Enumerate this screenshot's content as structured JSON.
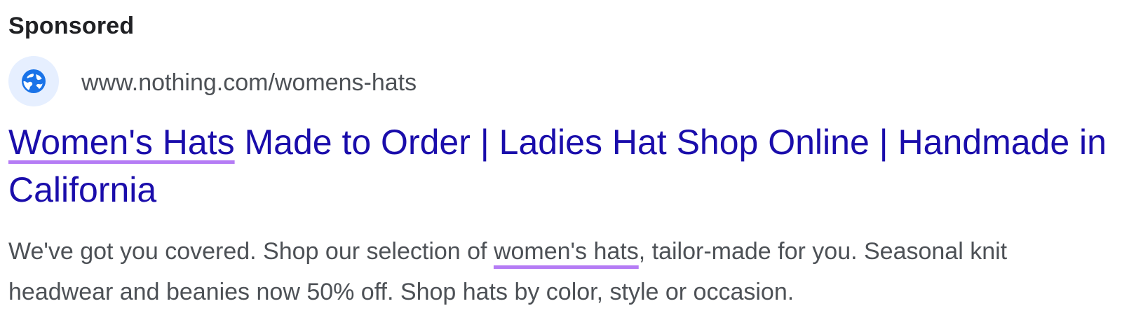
{
  "ad": {
    "label": "Sponsored",
    "icon": "globe-icon",
    "display_url": "www.nothing.com/womens-hats",
    "headline": {
      "highlight": "Women's Hats",
      "rest": " Made to Order | Ladies Hat Shop Online | Handmade in California"
    },
    "description": {
      "before": "We've got you covered. Shop our selection of ",
      "highlight": "women's hats",
      "after": ", tailor-made for you. Seasonal knit headwear and beanies now 50% off. Shop hats by color, style or occasion."
    }
  },
  "colors": {
    "title_link": "#1a0dab",
    "body_text": "#4d5156",
    "label_text": "#202124",
    "favicon_bg": "#e6efff",
    "favicon_icon": "#1a73e8",
    "highlight_underline": "#b57cf5"
  }
}
